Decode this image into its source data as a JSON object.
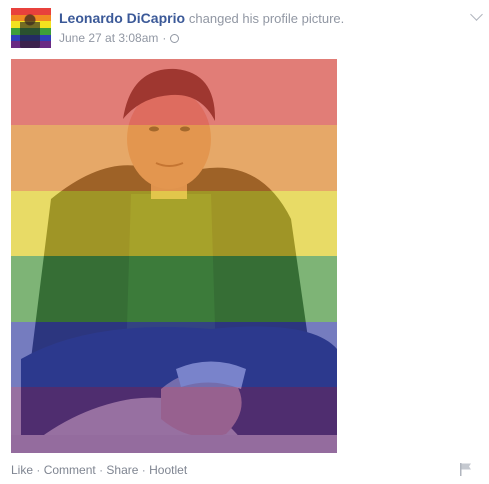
{
  "post": {
    "author": "Leonardo DiCaprio",
    "action": "changed his profile picture.",
    "timestamp": "June 27 at 3:08am",
    "separator": "·",
    "privacy_icon": "globe-icon",
    "menu_icon": "chevron-down-icon"
  },
  "rainbow": [
    "#e8413c",
    "#f18a22",
    "#f4e21f",
    "#3e9f3a",
    "#2e3fb8",
    "#6a2a84"
  ],
  "actions": {
    "like": "Like",
    "comment": "Comment",
    "share": "Share",
    "hootlet": "Hootlet",
    "sep": "·",
    "flag_icon": "flag-icon"
  }
}
